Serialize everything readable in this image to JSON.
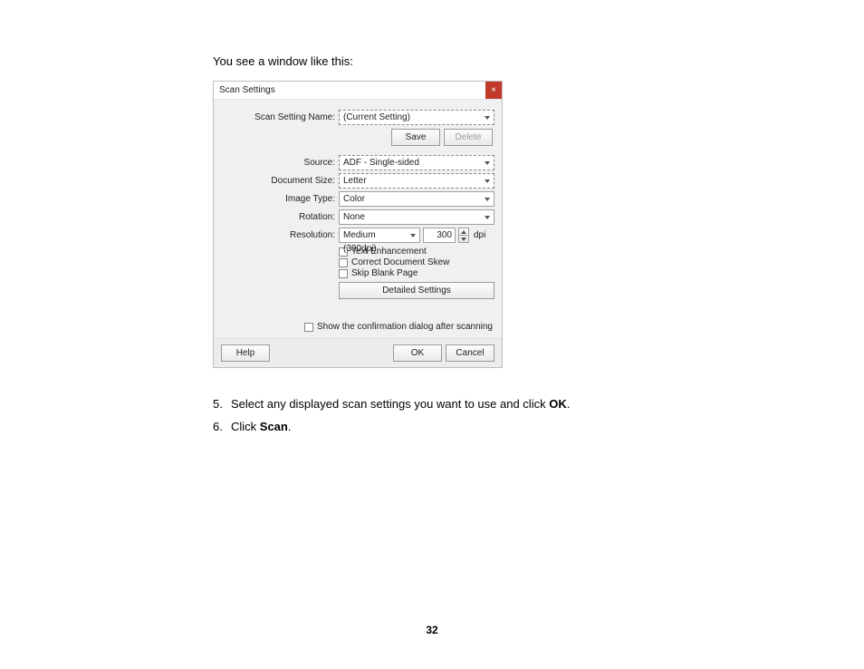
{
  "intro": "You see a window like this:",
  "dialog": {
    "title": "Scan Settings",
    "close_glyph": "×",
    "labels": {
      "scan_setting_name": "Scan Setting Name:",
      "source": "Source:",
      "document_size": "Document Size:",
      "image_type": "Image Type:",
      "rotation": "Rotation:",
      "resolution": "Resolution:"
    },
    "values": {
      "scan_setting_name": "(Current Setting)",
      "source": "ADF - Single-sided",
      "document_size": "Letter",
      "image_type": "Color",
      "rotation": "None",
      "resolution_preset": "Medium (300dpi)",
      "resolution_value": "300",
      "resolution_unit": "dpi"
    },
    "buttons": {
      "save": "Save",
      "delete": "Delete",
      "detailed_settings": "Detailed Settings",
      "help": "Help",
      "ok": "OK",
      "cancel": "Cancel"
    },
    "checkboxes": {
      "text_enhancement": "Text Enhancement",
      "correct_skew": "Correct Document Skew",
      "skip_blank": "Skip Blank Page",
      "show_confirmation": "Show the confirmation dialog after scanning"
    }
  },
  "steps": {
    "five_num": "5.",
    "five_a": "Select any displayed scan settings you want to use and click ",
    "five_b": "OK",
    "five_c": ".",
    "six_num": "6.",
    "six_a": "Click ",
    "six_b": "Scan",
    "six_c": "."
  },
  "page_number": "32"
}
